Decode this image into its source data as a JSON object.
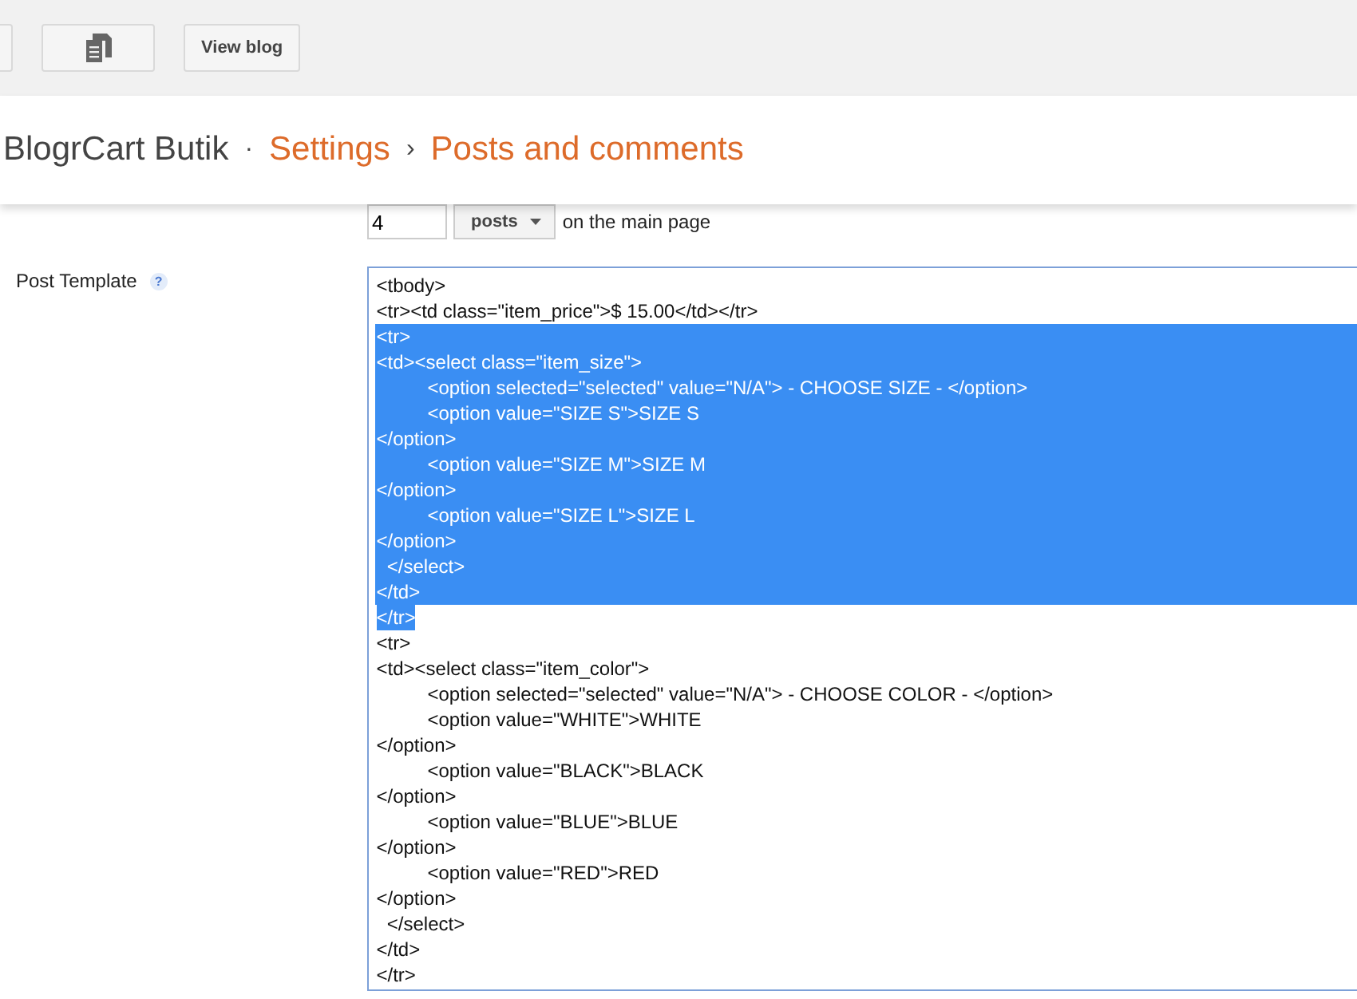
{
  "toolbar": {
    "buttons": [
      {
        "kind": "blank"
      },
      {
        "kind": "icon"
      },
      {
        "kind": "text",
        "label": "View blog"
      }
    ]
  },
  "breadcrumb": {
    "blog": "BlogrCart Butik",
    "dot": "·",
    "sep": "›",
    "items": [
      "Settings",
      "Posts and comments"
    ]
  },
  "posts_row": {
    "value": "4",
    "unit": "posts",
    "suffix": "on the main page"
  },
  "post_template": {
    "label": "Post Template",
    "help": "?",
    "lines": [
      {
        "text": "<tbody>",
        "selected": false
      },
      {
        "text": "<tr><td class=\"item_price\">$ 15.00</td></tr>",
        "selected": false
      },
      {
        "text": "<tr>",
        "selected": true
      },
      {
        "text": "<td><select class=\"item_size\">",
        "selected": true
      },
      {
        "text": "\t<option selected=\"selected\" value=\"N/A\"> - CHOOSE SIZE - </option>",
        "selected": true
      },
      {
        "text": "\t<option value=\"SIZE S\">SIZE S",
        "selected": true
      },
      {
        "text": "</option>",
        "selected": true
      },
      {
        "text": "\t<option value=\"SIZE M\">SIZE M",
        "selected": true
      },
      {
        "text": "</option>",
        "selected": true
      },
      {
        "text": "\t<option value=\"SIZE L\">SIZE L",
        "selected": true
      },
      {
        "text": "</option>",
        "selected": true
      },
      {
        "text": "  </select>",
        "selected": true
      },
      {
        "text": "</td>",
        "selected": true
      },
      {
        "text": "</tr>",
        "selected": true
      },
      {
        "text": "<tr>",
        "selected": false
      },
      {
        "text": "<td><select class=\"item_color\">",
        "selected": false
      },
      {
        "text": "\t<option selected=\"selected\" value=\"N/A\"> - CHOOSE COLOR - </option>",
        "selected": false
      },
      {
        "text": "\t<option value=\"WHITE\">WHITE",
        "selected": false
      },
      {
        "text": "</option>",
        "selected": false
      },
      {
        "text": "\t<option value=\"BLACK\">BLACK",
        "selected": false
      },
      {
        "text": "</option>",
        "selected": false
      },
      {
        "text": "\t<option value=\"BLUE\">BLUE",
        "selected": false
      },
      {
        "text": "</option>",
        "selected": false
      },
      {
        "text": "\t<option value=\"RED\">RED",
        "selected": false
      },
      {
        "text": "</option>",
        "selected": false
      },
      {
        "text": "  </select>",
        "selected": false
      },
      {
        "text": "</td>",
        "selected": false
      },
      {
        "text": "</tr>",
        "selected": false
      }
    ]
  }
}
